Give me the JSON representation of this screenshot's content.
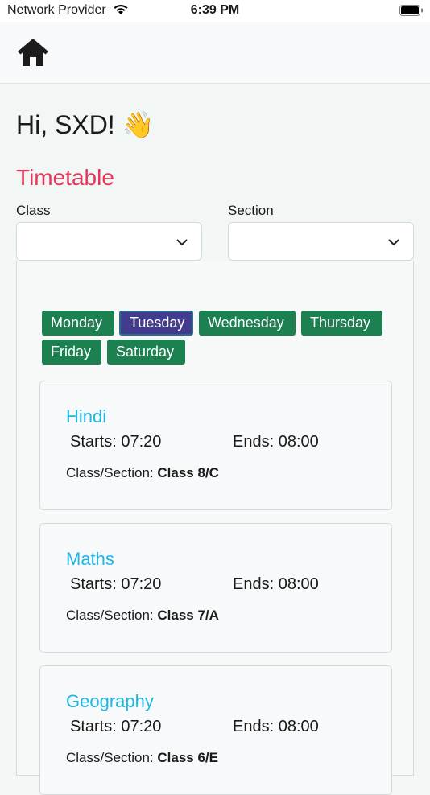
{
  "status_bar": {
    "carrier": "Network Provider",
    "time": "6:39 PM"
  },
  "greeting": "Hi, SXD! 👋",
  "section_title": "Timetable",
  "filters": {
    "class_label": "Class",
    "class_value": "",
    "section_label": "Section",
    "section_value": ""
  },
  "days": [
    {
      "label": "Monday",
      "active": false
    },
    {
      "label": "Tuesday",
      "active": true
    },
    {
      "label": "Wednesday",
      "active": false
    },
    {
      "label": "Thursday",
      "active": false
    },
    {
      "label": "Friday",
      "active": false
    },
    {
      "label": "Saturday",
      "active": false
    }
  ],
  "entries": [
    {
      "subject": "Hindi",
      "starts": "Starts: 07:20",
      "ends": "Ends: 08:00",
      "class_prefix": "Class/Section: ",
      "class_value": "Class 8/C"
    },
    {
      "subject": "Maths",
      "starts": "Starts: 07:20",
      "ends": "Ends: 08:00",
      "class_prefix": "Class/Section: ",
      "class_value": "Class 7/A"
    },
    {
      "subject": "Geography",
      "starts": "Starts: 07:20",
      "ends": "Ends: 08:00",
      "class_prefix": "Class/Section: ",
      "class_value": "Class 6/E"
    }
  ],
  "colors": {
    "accent_title": "#e8375a",
    "day_button": "#1d8050",
    "day_button_active": "#433c8e",
    "subject": "#1fb7e0"
  }
}
